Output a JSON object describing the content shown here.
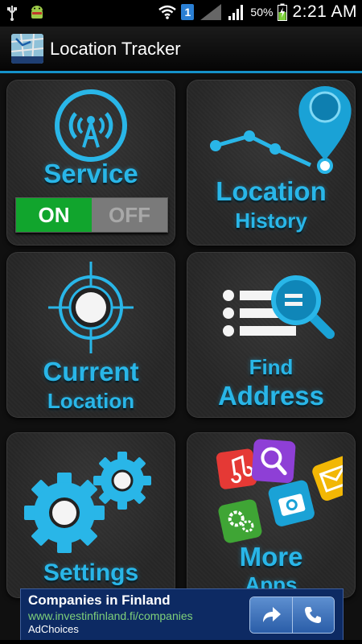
{
  "status_bar": {
    "notification_count": "1",
    "battery_percent": "50%",
    "time": "2:21 AM",
    "icons": [
      "usb-icon",
      "android-icon",
      "wifi-icon",
      "signal-icon",
      "battery-icon"
    ]
  },
  "app": {
    "title": "Location Tracker",
    "logo_caption": "Location Tracker"
  },
  "tiles": {
    "service": {
      "label": "Service",
      "toggle_on": "ON",
      "toggle_off": "OFF",
      "state": "on"
    },
    "history": {
      "line1": "Location",
      "line2": "History"
    },
    "current": {
      "line1": "Current",
      "line2": "Location"
    },
    "find": {
      "line1": "Find",
      "line2": "Address"
    },
    "settings": {
      "label": "Settings"
    },
    "more": {
      "line1": "More",
      "line2": "Apps"
    }
  },
  "ad": {
    "title": "Companies in Finland",
    "url": "www.investinfinland.fi/companies",
    "choices": "AdChoices"
  },
  "colors": {
    "accent": "#29b6e8",
    "toggle_on": "#11a52d",
    "toggle_off": "#7a7a7a",
    "ad_background": "#0d2a63"
  }
}
